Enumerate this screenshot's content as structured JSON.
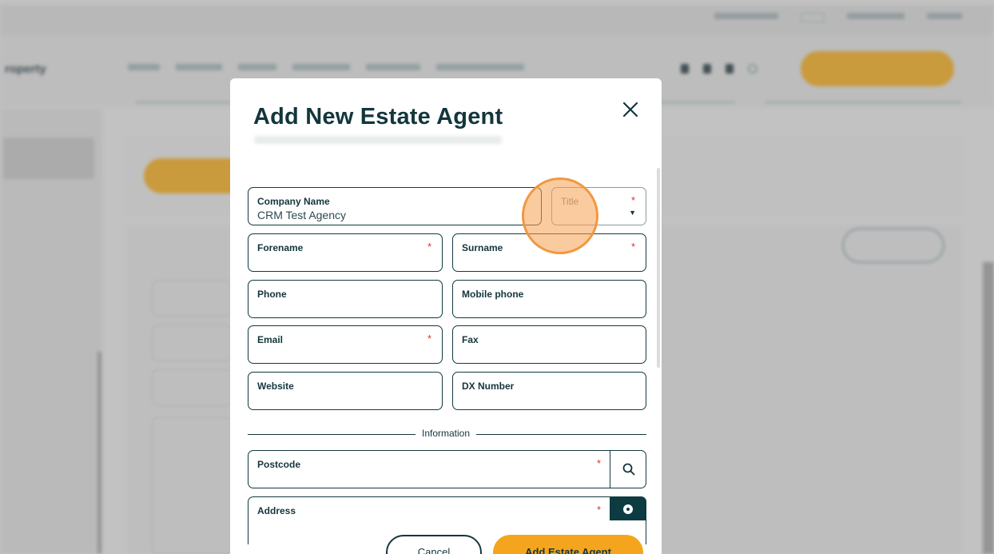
{
  "background": {
    "brand": "roperty",
    "top_links": [
      "",
      "",
      "",
      ""
    ],
    "nav_links": [
      "",
      "",
      "",
      "",
      "",
      ""
    ],
    "account_button": ""
  },
  "modal": {
    "title": "Add New Estate Agent",
    "fields": {
      "company_name": {
        "label": "Company Name",
        "value": "CRM Test Agency"
      },
      "title": {
        "label": "Title",
        "required": "*"
      },
      "forename": {
        "label": "Forename",
        "required": "*"
      },
      "surname": {
        "label": "Surname",
        "required": "*"
      },
      "phone": {
        "label": "Phone"
      },
      "mobile_phone": {
        "label": "Mobile phone"
      },
      "email": {
        "label": "Email",
        "required": "*"
      },
      "fax": {
        "label": "Fax"
      },
      "website": {
        "label": "Website"
      },
      "dx_number": {
        "label": "DX Number"
      },
      "postcode": {
        "label": "Postcode",
        "required": "*"
      },
      "address": {
        "label": "Address",
        "required": "*"
      }
    },
    "section_label": "Information",
    "buttons": {
      "cancel": "Cancel",
      "add": "Add Estate Agent"
    }
  },
  "colors": {
    "accent": "#f4a51d",
    "primary": "#13363c",
    "required": "#dd3333"
  }
}
